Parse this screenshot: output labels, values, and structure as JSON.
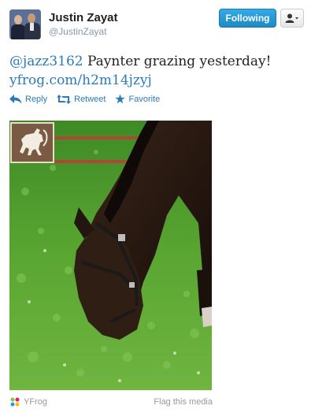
{
  "user": {
    "name": "Justin Zayat",
    "handle": "@JustinZayat"
  },
  "buttons": {
    "follow_label": "Following",
    "user_menu_icon": "user-dropdown-icon"
  },
  "tweet": {
    "mention": "@jazz3162",
    "text": " Paynter grazing yesterday!",
    "link": "yfrog.com/h2m14jzyj"
  },
  "actions": {
    "reply": "Reply",
    "retweet": "Retweet",
    "favorite": "Favorite"
  },
  "media": {
    "provider": "YFrog",
    "flag": "Flag this media"
  },
  "colors": {
    "link": "#2b7bb9",
    "follow_button": "#1e8ac4",
    "grass": "#4f9b2c",
    "horse": "#2a1c14"
  }
}
